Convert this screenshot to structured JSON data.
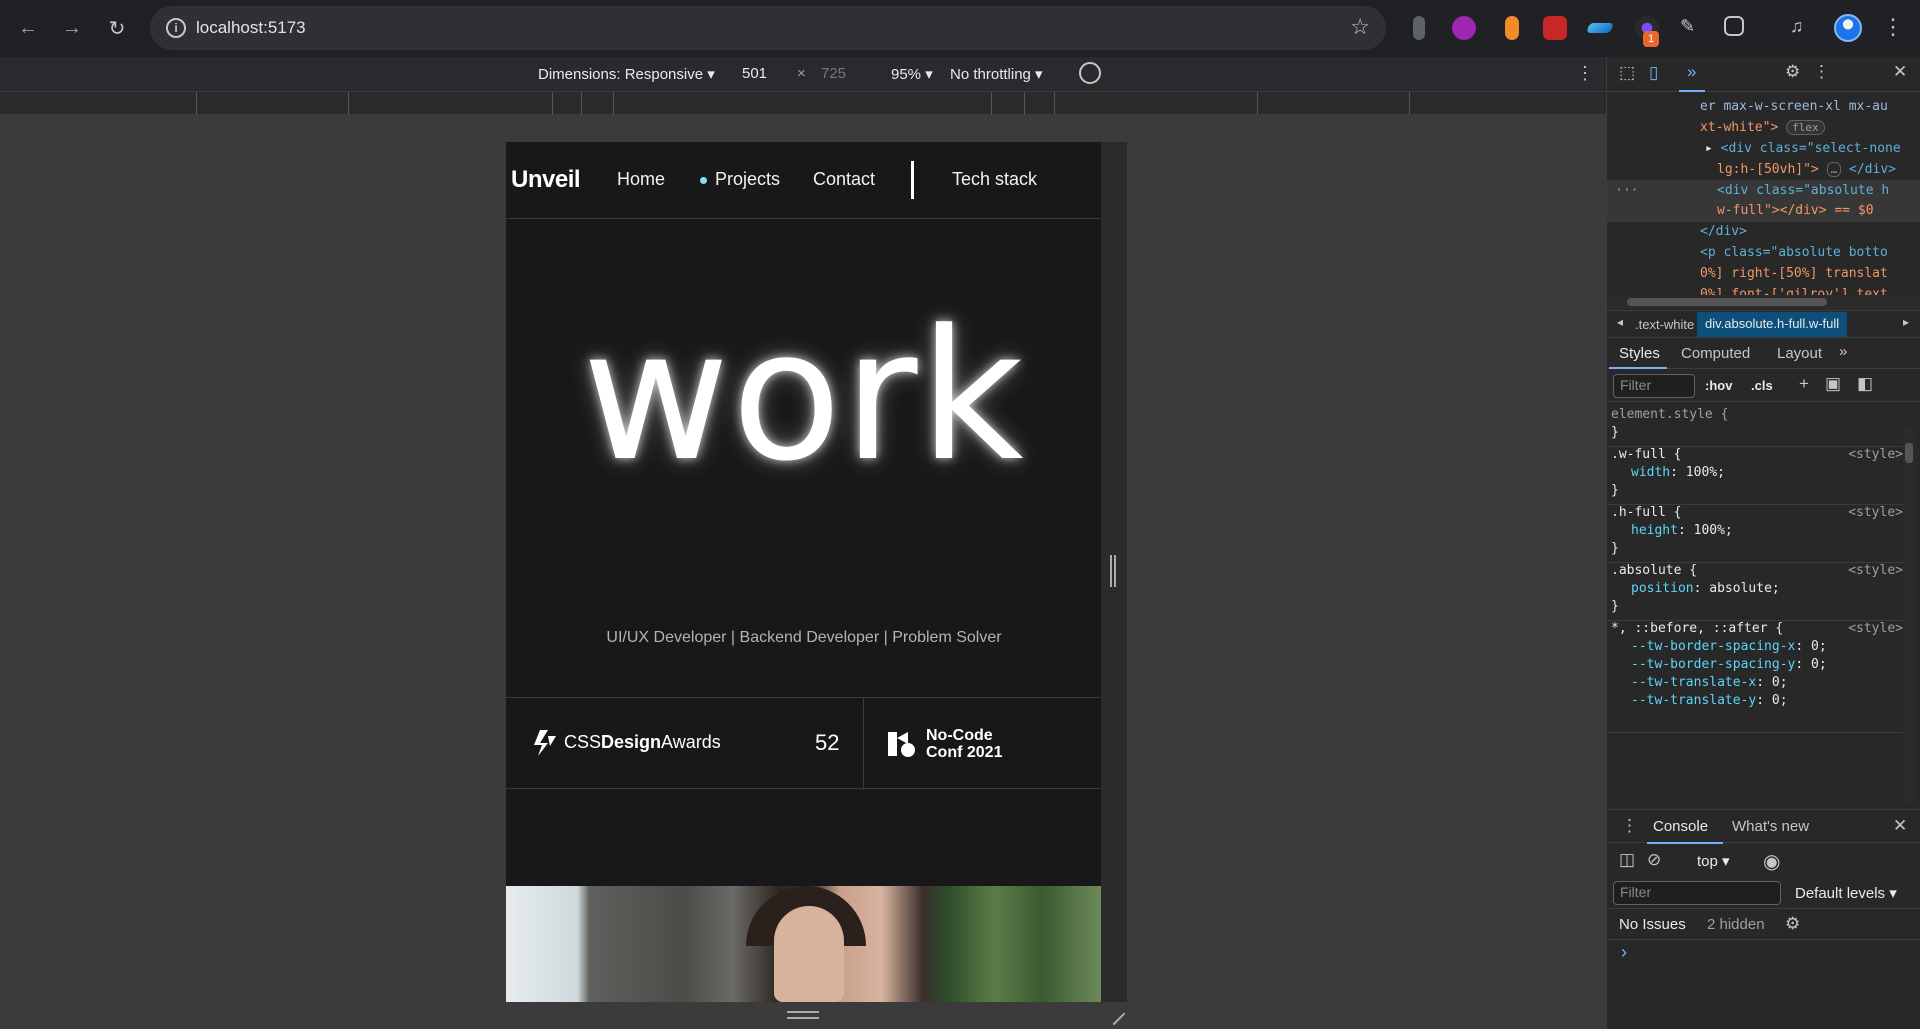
{
  "browser": {
    "url": "localhost:5173",
    "back_icon": "back-arrow-icon",
    "forward_icon": "forward-arrow-icon",
    "reload_icon": "reload-icon",
    "extension_badge": "1"
  },
  "device_toolbar": {
    "dimensions": "Dimensions: Responsive ▾",
    "width": "501",
    "times": "×",
    "height": "725",
    "zoom": "95% ▾",
    "throttling": "No throttling ▾"
  },
  "site": {
    "brand": "Unveil",
    "nav": [
      "Home",
      "Projects",
      "Contact",
      "Tech stack"
    ],
    "hero_word": "work",
    "hero_subtitle": "UI/UX Developer | Backend Developer | Problem Solver",
    "award_css_prefix": "CSS",
    "award_css_bold": "Design",
    "award_css_suffix": "Awards",
    "award_count": "52",
    "award_nc_line1": "No-Code",
    "award_nc_line2": "Conf 2021"
  },
  "devtools": {
    "elements_lines": [
      "er max-w-screen-xl mx-au",
      "xt-white\">",
      "<div class=\"select-none",
      "lg:h-[50vh]\">",
      "</div>",
      "<div class=\"absolute h",
      "w-full\"></div> == $0",
      "</div>",
      "<p class=\"absolute botto",
      "0%] right-[50%] translat",
      "0%] font-['gilroy'] text"
    ],
    "flex_badge": "flex",
    "ellipsis": "…",
    "row_dots": "···",
    "breadcrumb_prev": ".text-white",
    "breadcrumb_current": "div.absolute.h-full.w-full",
    "tabs": [
      "Styles",
      "Computed",
      "Layout",
      "»"
    ],
    "filter_placeholder": "Filter",
    "hov": ":hov",
    "cls": ".cls",
    "rules": [
      {
        "selector": "element.style {",
        "props": [],
        "source": ""
      },
      {
        "selector": ".w-full {",
        "props": [
          [
            "width",
            "100%;"
          ]
        ],
        "source": "<style>"
      },
      {
        "selector": ".h-full {",
        "props": [
          [
            "height",
            "100%;"
          ]
        ],
        "source": "<style>"
      },
      {
        "selector": ".absolute {",
        "props": [
          [
            "position",
            "absolute;"
          ]
        ],
        "source": "<style>"
      },
      {
        "selector": "*, ::before, ::after {",
        "props": [
          [
            "--tw-border-spacing-x",
            "0;"
          ],
          [
            "--tw-border-spacing-y",
            "0;"
          ],
          [
            "--tw-translate-x",
            "0;"
          ],
          [
            "--tw-translate-y",
            "0;"
          ]
        ],
        "source": "<style>"
      }
    ],
    "close_brace": "}",
    "console_tabs": [
      "Console",
      "What's new"
    ],
    "context": "top ▾",
    "console_filter": "Filter",
    "levels": "Default levels ▾",
    "issues": "No Issues",
    "hidden": "2 hidden",
    "prompt": "›"
  }
}
